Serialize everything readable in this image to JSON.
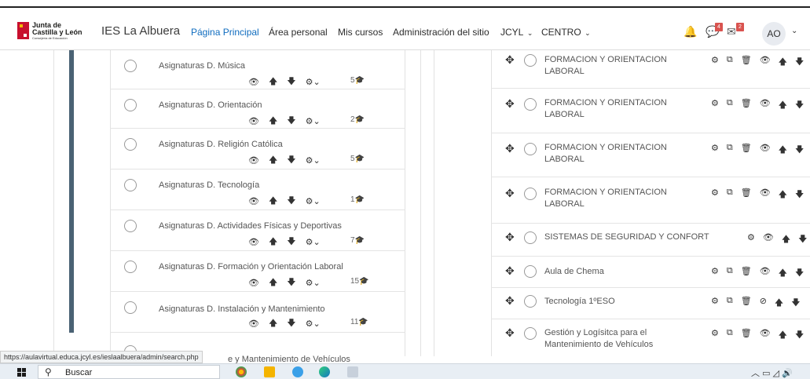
{
  "navbar": {
    "logo": {
      "line1": "Junta de",
      "line2": "Castilla y León",
      "line3": "Consejería de Educación"
    },
    "site_name": "IES La Albuera",
    "links": [
      "Página Principal",
      "Área personal",
      "Mis cursos",
      "Administración del sitio"
    ],
    "menus": [
      "JCYL",
      "CENTRO"
    ],
    "notification_badge": "4",
    "message_badge": "2",
    "avatar_initials": "AO"
  },
  "left_list": {
    "items": [
      {
        "title": "Asignaturas D. Música",
        "count": "5"
      },
      {
        "title": "Asignaturas D. Orientación",
        "count": "2"
      },
      {
        "title": "Asignaturas D. Religión Católica",
        "count": "5"
      },
      {
        "title": "Asignaturas D. Tecnología",
        "count": "1"
      },
      {
        "title": "Asignaturas D. Actividades Físicas y Deportivas",
        "count": "7"
      },
      {
        "title": "Asignaturas D. Formación y Orientación Laboral",
        "count": "15"
      },
      {
        "title": "Asignaturas D. Instalación y Mantenimiento",
        "count": "11"
      }
    ],
    "partial_item_text": "e y Mantenimiento de Vehículos"
  },
  "right_list": {
    "items": [
      {
        "line1": "FORMACION Y ORIENTACION",
        "line2": "LABORAL"
      },
      {
        "line1": "FORMACION Y ORIENTACION",
        "line2": "LABORAL"
      },
      {
        "line1": "FORMACION Y ORIENTACION",
        "line2": "LABORAL"
      },
      {
        "line1": "FORMACION Y ORIENTACION",
        "line2": "LABORAL"
      },
      {
        "line1": "SISTEMAS DE SEGURIDAD Y CONFORT",
        "line2": ""
      },
      {
        "line1": "Aula de Chema",
        "line2": ""
      },
      {
        "line1": "Tecnología 1ºESO",
        "line2": ""
      },
      {
        "line1": "Gestión y Logísitca para el",
        "line2": "Mantenimiento de Vehículos"
      }
    ]
  },
  "status_url": "https://aulavirtual.educa.jcyl.es/ieslaalbuera/admin/search.php",
  "taskbar": {
    "search_label": "Buscar"
  },
  "colors": {
    "accent": "#0f6cbf",
    "sidebar_bar": "#4a6274",
    "badge": "#d9534f"
  }
}
